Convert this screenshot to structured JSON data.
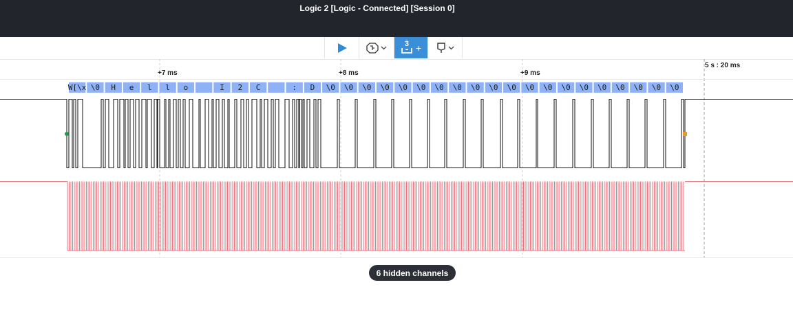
{
  "window": {
    "title": "Logic 2 [Logic - Connected] [Session 0]"
  },
  "toolbar": {
    "buttons": [
      {
        "name": "play-button",
        "icon": "play-icon"
      },
      {
        "name": "trigger-menu-button",
        "icon": "trigger-icon"
      },
      {
        "name": "measure-button",
        "icon": "measure-icon",
        "badge": "3",
        "plus": "+"
      },
      {
        "name": "marker-menu-button",
        "icon": "flag-icon"
      }
    ]
  },
  "timeline": {
    "ticks": [
      "+7 ms",
      "+8 ms",
      "+9 ms"
    ],
    "cursor_label": "5 s : 20 ms"
  },
  "decoder": {
    "frames": [
      "W[\\x",
      "\\0",
      "H",
      "e",
      "l",
      "l",
      "o",
      "",
      "I",
      "2",
      "C",
      "",
      ":",
      "D",
      "\\0",
      "\\0",
      "\\0",
      "\\0",
      "\\0",
      "\\0",
      "\\0",
      "\\0",
      "\\0",
      "\\0",
      "\\0",
      "\\0",
      "\\0",
      "\\0",
      "\\0",
      "\\0",
      "\\0",
      "\\0",
      "\\0",
      "\\0"
    ]
  },
  "hidden_channels": {
    "label": "6 hidden channels"
  },
  "colors": {
    "titlebar": "#22252b",
    "accent": "#3b8fd9",
    "decoder_fill": "#8eb2f5",
    "clock_wave": "#e8737c",
    "data_wave": "#111111",
    "marker_start": "#1e9b4f",
    "marker_end": "#f0952d"
  }
}
